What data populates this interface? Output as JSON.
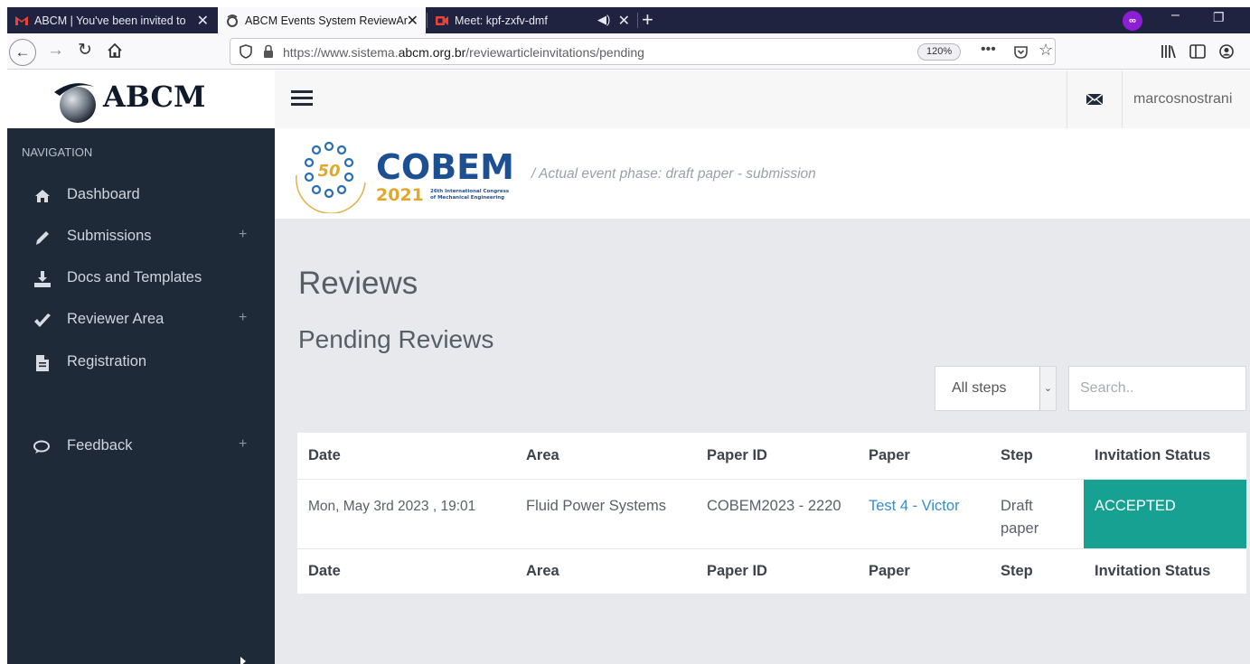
{
  "browser": {
    "tabs": [
      {
        "title": "ABCM | You've been invited to",
        "favicon": "gmail-icon"
      },
      {
        "title": "ABCM Events System ReviewAr",
        "favicon": "abcm-icon",
        "active": true
      },
      {
        "title": "Meet: kpf-zxfv-dmf",
        "favicon": "meet-icon"
      }
    ],
    "url": {
      "prefix": "https://www.sistema.",
      "domain": "abcm.org.br",
      "path": "/reviewarticleinvitations/pending"
    },
    "zoom": "120%",
    "private_color": "#8c1fd6"
  },
  "header": {
    "logo_text": "ABCM",
    "username": "marcosnostrani"
  },
  "sidebar": {
    "heading": "NAVIGATION",
    "items": [
      {
        "label": "Dashboard",
        "icon": "home-icon",
        "expandable": false
      },
      {
        "label": "Submissions",
        "icon": "pencil-icon",
        "expandable": true
      },
      {
        "label": "Docs and Templates",
        "icon": "download-icon",
        "expandable": false
      },
      {
        "label": "Reviewer Area",
        "icon": "check-icon",
        "expandable": true
      },
      {
        "label": "Registration",
        "icon": "document-icon",
        "expandable": false
      },
      {
        "label": "Feedback",
        "icon": "comments-icon",
        "expandable": true
      }
    ],
    "expand_symbol": "+",
    "bg_color": "#1f2a38"
  },
  "event": {
    "logo_brand": "COBEM",
    "logo_year": "2021",
    "logo_anniversary": "50",
    "logo_subtitle_1": "26th International Congress",
    "logo_subtitle_2": "of Mechanical Engineering",
    "phase": "/  Actual event phase: draft paper - submission"
  },
  "main": {
    "title": "Reviews",
    "section_title": "Pending Reviews",
    "filter": {
      "selected": "All steps"
    },
    "search": {
      "placeholder": "Search.."
    }
  },
  "table": {
    "columns": [
      "Date",
      "Area",
      "Paper ID",
      "Paper",
      "Step",
      "Invitation Status"
    ],
    "rows": [
      {
        "date": "Mon, May 3rd 2023 , 19:01",
        "area": "Fluid Power Systems",
        "paper_id": "COBEM2023 - 2220",
        "paper": "Test 4 - Victor",
        "step": "Draft paper",
        "status": "ACCEPTED"
      }
    ],
    "status_color": "#16a192",
    "link_color": "#3b8cc8"
  }
}
